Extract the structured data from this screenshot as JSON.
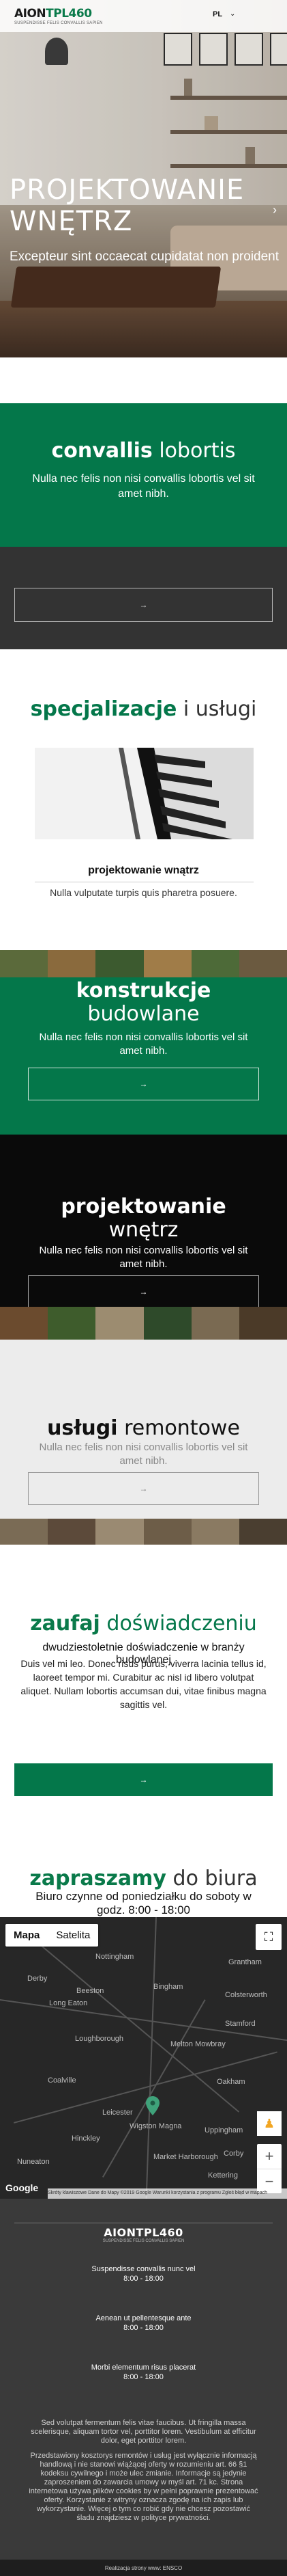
{
  "header": {
    "logo": {
      "part1": "AION",
      "part2": "TPL460",
      "tagline": "SUSPENDISSE FELIS CONVALLIS SAPIEN"
    },
    "language": "PL"
  },
  "hero": {
    "title_line1": "PROJEKTOWANIE",
    "title_line2": "WNĘTRZ",
    "subtitle": "Excepteur sint occaecat cupidatat non proident",
    "next_icon": "chevron-right-icon"
  },
  "intro": {
    "title_bold": "convallis",
    "title_light": " lobortis",
    "text": "Nulla nec felis non nisi convallis lobortis vel sit amet nibh."
  },
  "darkband": {
    "button_icon": "arrow-right-icon"
  },
  "specializations": {
    "title_bold": "specjalizacje",
    "title_light": " i usługi",
    "caption": "projektowanie wnątrz",
    "description": "Nulla vulputate turpis quis pharetra posuere."
  },
  "cards": [
    {
      "title_bold": "konstrukcje",
      "title_light": "budowlane",
      "text": "Nulla nec felis non nisi convallis lobortis vel sit amet nibh.",
      "button_icon": "arrow-right-icon"
    },
    {
      "title_bold": "projektowanie",
      "title_light": "wnętrz",
      "text": "Nulla nec felis non nisi convallis lobortis vel sit amet nibh.",
      "button_icon": "arrow-right-icon"
    },
    {
      "title_bold": "usługi",
      "title_light": " remontowe",
      "text": "Nulla nec felis non nisi convallis lobortis vel sit amet nibh.",
      "button_icon": "arrow-right-icon"
    }
  ],
  "experience": {
    "title_bold": "zaufaj",
    "title_light": " doświadczeniu",
    "subtitle": "dwudziestoletnie doświadczenie w branży budowlanej",
    "text": "Duis vel mi leo. Donec risus purus, viverra lacinia tellus id, laoreet tempor mi. Curabitur ac nisl id libero volutpat aliquet. Nullam lobortis accumsan dui, vitae finibus magna sagittis vel.",
    "button_icon": "arrow-right-icon"
  },
  "contact": {
    "title_bold": "zapraszamy",
    "title_light": " do biura",
    "hours": "Biuro czynne od poniedziałku do soboty w godz. 8:00 - 18:00"
  },
  "map": {
    "tabs": [
      "Mapa",
      "Satelita"
    ],
    "towns": [
      "Nottingham",
      "Derby",
      "Grantham",
      "Beeston",
      "Long Eaton",
      "Bingham",
      "Loughborough",
      "Melton Mowbray",
      "Coalville",
      "Leicester",
      "Oakham",
      "Hinckley",
      "Wigston Magna",
      "Uppingham",
      "Market Harborough",
      "Corby",
      "Nuneaton",
      "Kettering",
      "Stamford",
      "Colsterworth"
    ],
    "logo": "Google",
    "attribution": "Skróty klawiszowe   Dane do Mapy ©2019 Google   Warunki korzystania z programu   Zgłoś błąd w mapach"
  },
  "footer": {
    "logo": "AIONTPL460",
    "tagline": "SUSPENDISSE FELIS CONVALLIS SAPIEN",
    "blocks": [
      {
        "title": "Suspendisse convallis nunc vel",
        "hours": "8:00 - 18:00"
      },
      {
        "title": "Aenean ut pellentesque ante",
        "hours": "8:00 - 18:00"
      },
      {
        "title": "Morbi elementum risus placerat",
        "hours": "8:00 - 18:00"
      }
    ],
    "para1": "Sed volutpat fermentum felis vitae faucibus. Ut fringilla massa scelerisque, aliquam tortor vel, porttitor lorem. Vestibulum at efficitur dolor, eget porttitor lorem.",
    "para2": "Przedstawiony kosztorys remontów i usług jest wyłącznie informacją handlową i nie stanowi wiążącej oferty w rozumieniu art. 66 §1 kodeksu cywilnego i może ulec zmianie. Informacje są jedynie zaproszeniem do zawarcia umowy w myśl art. 71 kc. Strona internetowa używa plików cookies by w pełni poprawnie prezentować oferty. Korzystanie z witryny oznacza zgodę na ich zapis lub wykorzystanie. Więcej o tym co robić gdy nie chcesz pozostawić śladu znajdziesz w polityce prywatności."
  },
  "bottom_bar": "Realizacja strony www: ENSCO"
}
